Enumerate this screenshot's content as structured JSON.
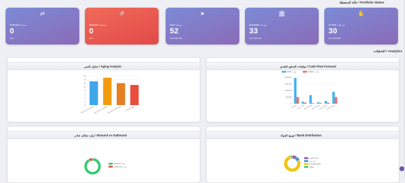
{
  "portfolio_title": "حالة المحفظة / Portfolio Status",
  "analytics_title": "التحليلات / Analytics",
  "cards": [
    {
      "id": "extended",
      "icon": "⇄",
      "label": "Extended / ممتدة",
      "value": "0",
      "sub": "LE 0",
      "color": "purple"
    },
    {
      "id": "returned",
      "icon": "↺",
      "label": "Returned / مرتجعة",
      "value": "0",
      "sub": "LE 0",
      "color": "red"
    },
    {
      "id": "sent",
      "icon": "➤",
      "label": "Sent / مرسلة",
      "value": "52",
      "sub": "LE 5,280,495",
      "color": "purple"
    },
    {
      "id": "deposited",
      "icon": "🏛",
      "label": "Deposited / مودعة",
      "value": "33",
      "sub": "LE 3,255,163",
      "color": "purple"
    },
    {
      "id": "inhand",
      "icon": "✋",
      "label": "In Hand / في اليد",
      "value": "30",
      "sub": "LE 3,523,800",
      "color": "purple"
    }
  ],
  "panels": {
    "cash_flow": "توقعات التدفق النقدي / Cash Flow Forecast",
    "aging": "تحليل العمر / Aging Analysis",
    "bank": "توزيع البنوك / Bank Distribution",
    "inout": "وارد مقابل صادر / Inbound vs Outbound"
  },
  "colors": {
    "inflow": "#3fb5f0",
    "outflow": "#ef6a6a",
    "inbound": "#2ecc71",
    "outbound": "#e74c3c"
  },
  "chart_data": [
    {
      "type": "bar",
      "title": "Aging Analysis",
      "categories": [
        "Next 30 (1-30 days)",
        "Next 60 (31-60 days)",
        "Next 90 (61-90 days)",
        "Over 90 days"
      ],
      "values": [
        13,
        15,
        12,
        11
      ],
      "colors": [
        "#3fa7e8",
        "#f39c12",
        "#e67e22",
        "#e74c3c"
      ],
      "ylim": [
        0,
        16
      ],
      "yticks": [
        0,
        2,
        4,
        6,
        8,
        10,
        12,
        14,
        16
      ],
      "grid": true
    },
    {
      "type": "bar",
      "title": "Cash Flow Forecast",
      "categories": [
        "Overdue",
        "Next 7 days",
        "Next 30 days",
        "Next 60 days",
        "Next 90 days",
        "Over 90 days"
      ],
      "series": [
        {
          "name": "Inflow / وارد",
          "values": [
            1950000,
            150000,
            650000,
            100000,
            200000,
            900000
          ]
        },
        {
          "name": "Outflow / صادر",
          "values": [
            500000,
            80000,
            40000,
            50000,
            70000,
            500000
          ]
        }
      ],
      "ylim": [
        0,
        2000000
      ],
      "yticks": [
        "0",
        "500,000",
        "1,000,000",
        "1,500,000",
        "2,000,000"
      ],
      "legend": "top"
    },
    {
      "type": "pie",
      "title": "Inbound vs Outbound",
      "labels": [
        "Inbound / وارد",
        "Outbound / صادر"
      ],
      "values": [
        92,
        8
      ],
      "colors": [
        "#2ecc71",
        "#e74c3c"
      ],
      "legend": "right"
    },
    {
      "type": "pie",
      "title": "Bank Distribution",
      "labels": [
        "البنك الأهلي",
        "بنك مصر",
        "Not deposited",
        "Other"
      ],
      "values": [
        10,
        8,
        78,
        4
      ],
      "colors": [
        "#9b59b6",
        "#3498db",
        "#f1c40f",
        "#2ecc71"
      ],
      "legend": "right"
    }
  ]
}
